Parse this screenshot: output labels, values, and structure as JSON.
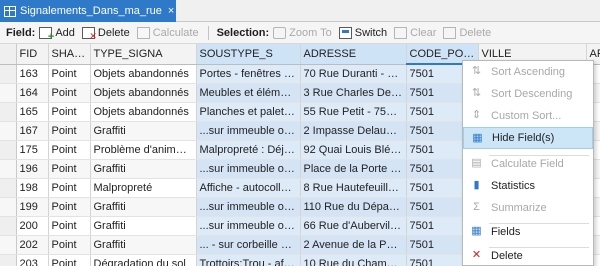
{
  "tab": {
    "title": "Signalements_Dans_ma_rue",
    "close_glyph": "×"
  },
  "toolbar": {
    "field_label": "Field:",
    "add_label": "Add",
    "delete_label": "Delete",
    "calculate_label": "Calculate",
    "selection_label": "Selection:",
    "zoom_to_label": "Zoom To",
    "switch_label": "Switch",
    "clear_label": "Clear",
    "delete_sel_label": "Delete"
  },
  "table": {
    "columns": [
      "FID",
      "SHAPE",
      "TYPE_SIGNA",
      "SOUSTYPE_S",
      "ADRESSE",
      "CODE_POSTA",
      "VILLE",
      "AR"
    ],
    "rows": [
      [
        "163",
        "Point",
        "Objets abandonnés",
        "Portes - fenêtres - vo...",
        "70 Rue Duranti - 7501...",
        "7501",
        "",
        ""
      ],
      [
        "164",
        "Point",
        "Objets abandonnés",
        "Meubles et éléments...",
        "3 Rue Charles Delescl...",
        "7501",
        "",
        ""
      ],
      [
        "165",
        "Point",
        "Objets abandonnés",
        "Planches et palettes",
        "55 Rue Petit - 75019...",
        "7501",
        "",
        ""
      ],
      [
        "167",
        "Point",
        "Graffiti",
        "...sur immeuble ou...",
        "2 Impasse Delaunay -...",
        "7501",
        "",
        ""
      ],
      [
        "175",
        "Point",
        "Problème d'animaux",
        "Malpropreté : Déjecti...",
        "92 Quai Louis Blériot...",
        "7501",
        "",
        ""
      ],
      [
        "196",
        "Point",
        "Graffiti",
        "...sur immeuble ou...",
        "Place de la Porte Mai...",
        "7501",
        "",
        ""
      ],
      [
        "198",
        "Point",
        "Malpropreté",
        "Affiche - autocollant:...",
        "8 Rue Hautefeuille - ...",
        "7501",
        "",
        ""
      ],
      [
        "199",
        "Point",
        "Graffiti",
        "...sur immeuble ou...",
        "110 Rue du Départem...",
        "7501",
        "",
        ""
      ],
      [
        "200",
        "Point",
        "Graffiti",
        "...sur immeuble ou...",
        "66 Rue d'Aubervillier...",
        "7501",
        "",
        ""
      ],
      [
        "202",
        "Point",
        "Graffiti",
        "... - sur corbeille à déc...",
        "2 Avenue de la Porte...",
        "7501",
        "",
        ""
      ],
      [
        "203",
        "Point",
        "Dégradation du sol",
        "Trottoirs:Trou - affais...",
        "10 Rue du Champ d...",
        "7501",
        "",
        ""
      ]
    ]
  },
  "context_menu": {
    "items": [
      {
        "label": "Sort Ascending",
        "icon": "sort-ascending-icon",
        "glyph": "⇅",
        "enabled": false,
        "highlighted": false
      },
      {
        "label": "Sort Descending",
        "icon": "sort-descending-icon",
        "glyph": "⇅",
        "enabled": false,
        "highlighted": false
      },
      {
        "label": "Custom Sort...",
        "icon": "custom-sort-icon",
        "glyph": "⇕",
        "enabled": false,
        "highlighted": false
      },
      {
        "label": "Hide Field(s)",
        "icon": "hide-field-icon",
        "glyph": "▦",
        "enabled": true,
        "highlighted": true
      },
      {
        "label": "Calculate Field",
        "icon": "calculate-field-icon",
        "glyph": "▤",
        "enabled": false,
        "highlighted": false
      },
      {
        "label": "Statistics",
        "icon": "statistics-icon",
        "glyph": "▮",
        "enabled": true,
        "highlighted": false
      },
      {
        "label": "Summarize",
        "icon": "summarize-icon",
        "glyph": "Σ",
        "enabled": false,
        "highlighted": false
      },
      {
        "label": "Fields",
        "icon": "fields-icon",
        "glyph": "▦",
        "enabled": true,
        "highlighted": false
      },
      {
        "label": "Delete",
        "icon": "delete-field-icon",
        "glyph": "✕",
        "enabled": true,
        "highlighted": false
      }
    ]
  },
  "colors": {
    "accent": "#2f79c9",
    "selected_column": "#ddeaf7",
    "menu_highlight": "#cde6f7",
    "delete_red": "#d22222"
  }
}
